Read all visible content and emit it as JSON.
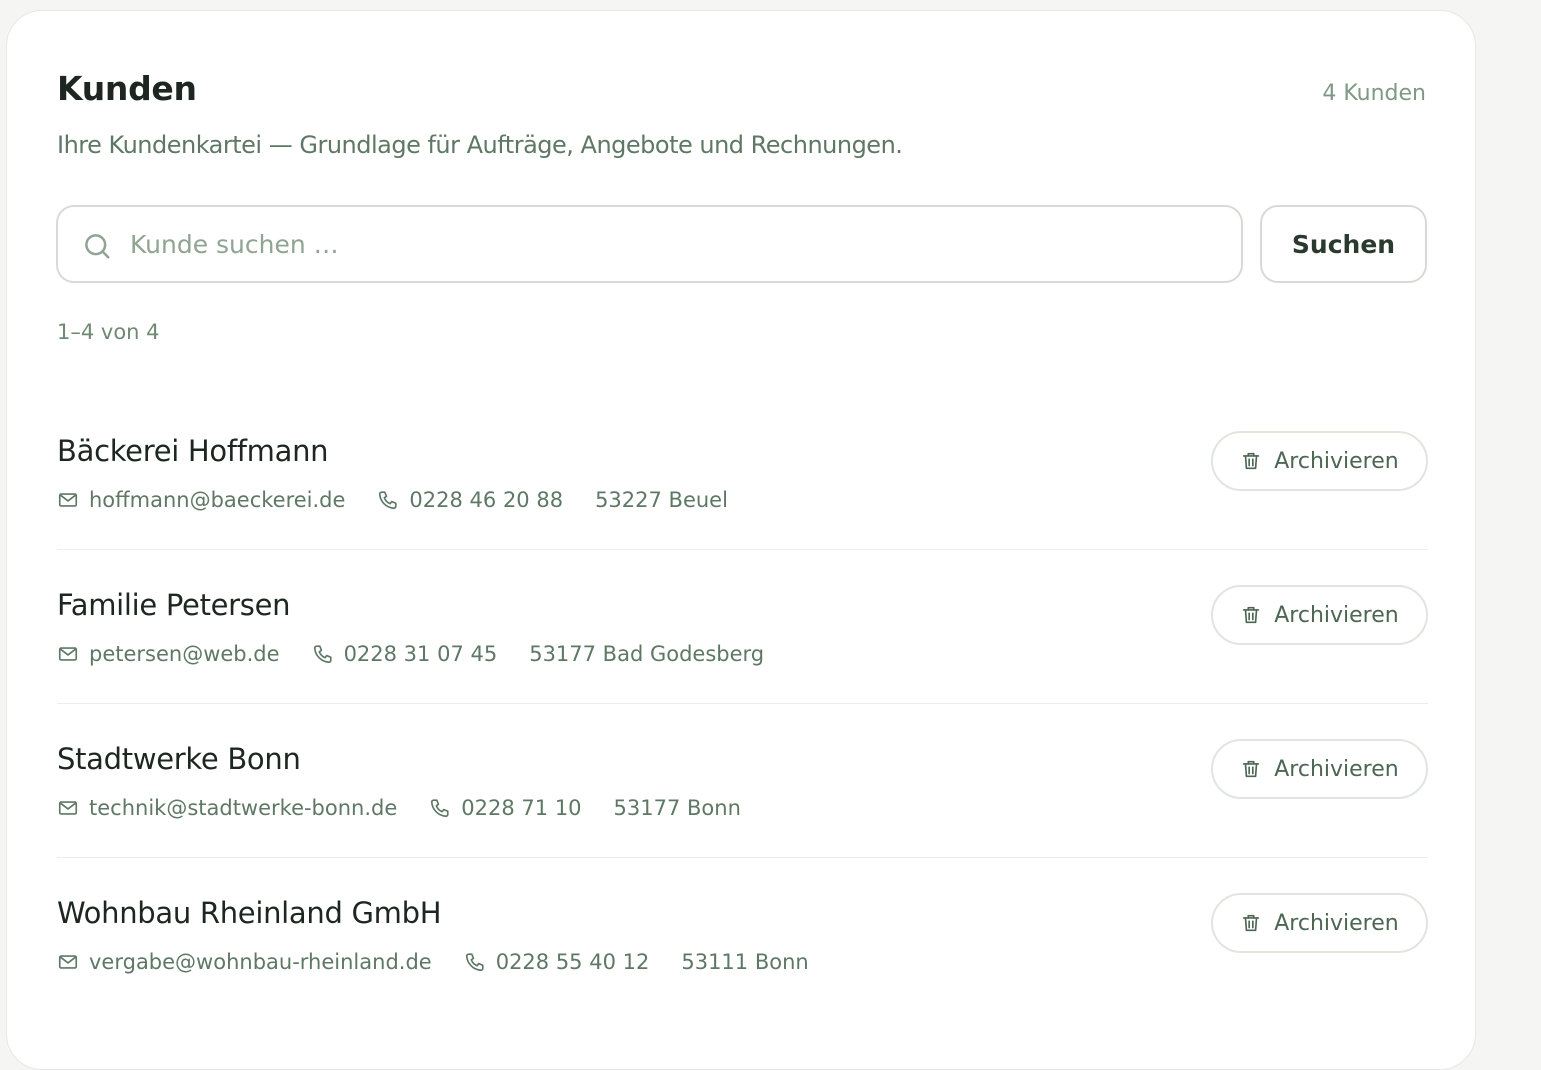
{
  "header": {
    "title": "Kunden",
    "count": "4 Kunden",
    "subtitle": "Ihre Kundenkartei — Grundlage für Aufträge, Angebote und Rechnungen."
  },
  "search": {
    "placeholder": "Kunde suchen …",
    "value": "",
    "button_label": "Suchen",
    "icon": "search-icon"
  },
  "pagination": {
    "range_label": "1–4 von 4"
  },
  "customers": [
    {
      "name": "Bäckerei Hoffmann",
      "email": "hoffmann@baeckerei.de",
      "phone": "0228 46 20 88",
      "location": "53227 Beuel",
      "archive_label": "Archivieren"
    },
    {
      "name": "Familie Petersen",
      "email": "petersen@web.de",
      "phone": "0228 31 07 45",
      "location": "53177 Bad Godesberg",
      "archive_label": "Archivieren"
    },
    {
      "name": "Stadtwerke Bonn",
      "email": "technik@stadtwerke-bonn.de",
      "phone": "0228 71 10",
      "location": "53177 Bonn",
      "archive_label": "Archivieren"
    },
    {
      "name": "Wohnbau Rheinland GmbH",
      "email": "vergabe@wohnbau-rheinland.de",
      "phone": "0228 55 40 12",
      "location": "53111 Bonn",
      "archive_label": "Archivieren"
    }
  ],
  "icons": {
    "email": "mail-icon",
    "phone": "phone-icon",
    "archive": "trash-icon"
  },
  "colors": {
    "accent": "#5f7865",
    "title": "#1d2620",
    "muted": "#7f9985",
    "border": "#d6dcd3"
  }
}
